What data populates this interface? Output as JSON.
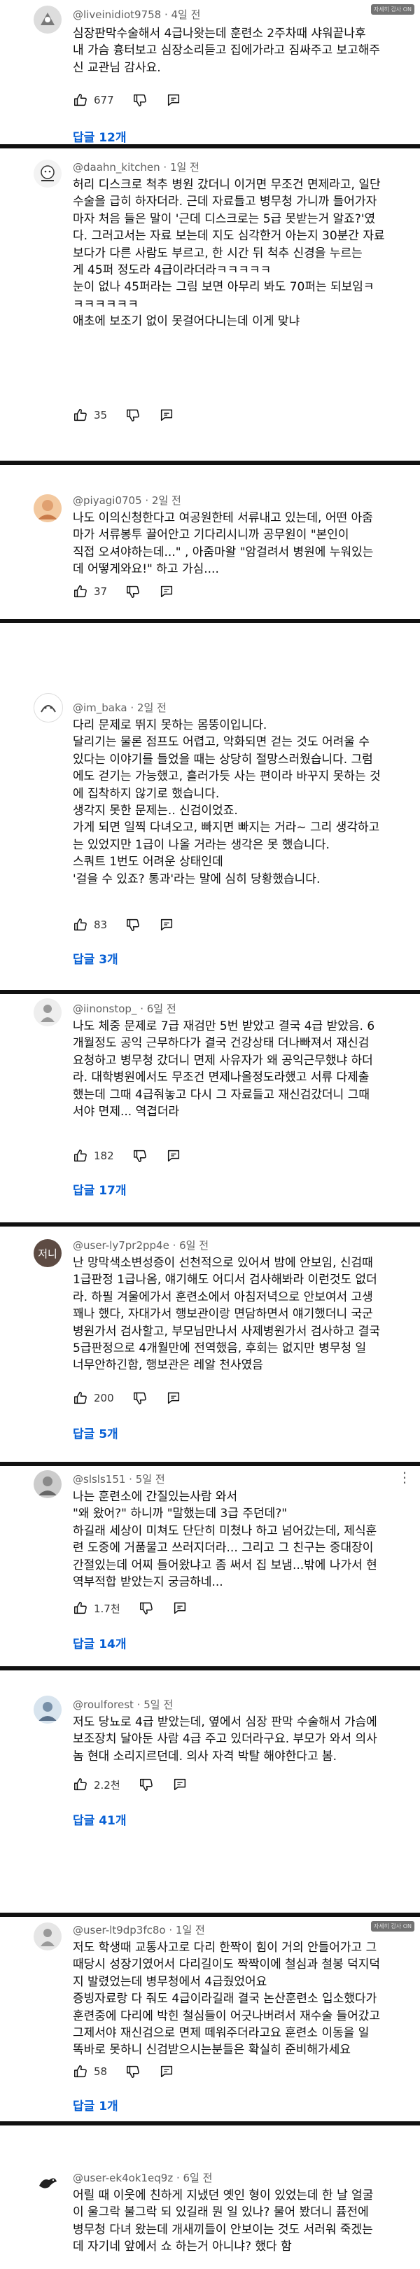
{
  "labels": {
    "replies_1": "답글 12개",
    "replies_3": "답글 3개",
    "replies_4": "답글 17개",
    "replies_5": "답글 5개",
    "replies_6": "답글 14개",
    "replies_7": "답글 41개",
    "replies_8": "답글 1개"
  },
  "comments": [
    {
      "handle": "@liveinidiot9758 · 4일 전",
      "text": "심장판막수술해서 4급나왓는데 훈련소 2주차때 샤워끝나후\n내 가슴 흉터보고 심장소리듣고 집에가라고 짐싸주고 보고해주\n신 교관님 감사요.",
      "likes": "677",
      "overlay": "자세히 감사 ON"
    },
    {
      "handle": "@daahn_kitchen · 1일 전",
      "text": "허리 디스크로 척추 병원 갔더니 이거면 무조건 면제라고, 일단\n수술을 급히 하자더라. 근데 자료들고 병무청 가니까 들어가자\n마자 처음 들은 말이 '근데 디스크로는 5급 못받는거 알죠?'였\n다. 그러고서는 자료 보는데 지도 심각한거 아는지 30분간 자료\n보다가 다른 사람도 부르고, 한 시간 뒤 척추 신경을 누르는\n게 45퍼 정도라 4급이라더라ㅋㅋㅋㅋㅋ\n눈이 없나 45퍼라는 그림 보면 아무리 봐도 70퍼는 되보임ㅋ\nㅋㅋㅋㅋㅋㅋ\n애초에 보조기 없이 못걸어다니는데 이게 맞냐",
      "likes": "35"
    },
    {
      "handle": "@piyagi0705 · 2일 전",
      "text": "나도 이의신청한다고 여공원한테 서류내고 있는데, 어떤 아줌\n마가 서류봉투 끌어안고 기다리시니까  공무원이 \"본인이\n직접 오셔야하는데...\" , 아줌마왈 \"암걸려서 병원에 누워있는\n데 어떻게와요!\" 하고 가심....",
      "likes": "37"
    },
    {
      "handle": "@im_baka · 2일 전",
      "text": "다리 문제로 뛰지 못하는 몸뚱이입니다.\n달리기는 물론 점프도 어렵고, 악화되면 걷는 것도 어려울 수\n있다는 이야기를 들었을 때는 상당히 절망스러웠습니다. 그럼\n에도 걷기는 가능했고, 흘러가듯 사는 편이라 바꾸지 못하는 것\n에 집착하지 않기로 했습니다.\n생각지 못한 문제는.. 신검이었죠.\n가게 되면 일찍 다녀오고, 빠지면 빠지는 거라~ 그리 생각하고\n는 있었지만 1급이 나올 거라는 생각은 못 했습니다.\n스쿼트 1번도 어려운 상태인데\n'걸을 수 있죠? 통과'라는 말에 심히 당황했습니다.",
      "likes": "83"
    },
    {
      "handle": "@iinonstop_ · 6일 전",
      "text": "나도 체중 문제로 7급 재검만 5번 받았고 결국 4급 받았음. 6\n개월정도 공익 근무하다가 결국 건강상태 더나빠져서 재신검\n요청하고 병무청 갔더니 면제 사유자가 왜 공익근무했냐 하더\n라.  대학병원에서도 무조건 면제나올정도라했고 서류 다제출\n했는데 그때 4급줘놓고 다시 그 자료들고 재신검갔더니 그때\n서야 면제... 역겹더라",
      "likes": "182"
    },
    {
      "handle": "@user-ly7pr2pp4e · 6일 전",
      "text": "난 망막색소변성증이 선천적으로 있어서 밤에 안보임, 신검때\n1급판정 1급나옴, 얘기해도 어디서 검사해봐라 이런것도 없더\n라. 하필 겨울에가서 훈련소에서 아침저녁으로 안보여서 고생\n꽤나 했다, 자대가서 행보관이랑 면담하면서 얘기했더니 국군\n병원가서 검사할고, 부모님만나서 사제병원가서 검사하고 결국\n5급판정으로 4개월만에 전역했음, 후회는 없지만 병무청 일\n너무안하긴함, 행보관은 레알 천사였음",
      "likes": "200"
    },
    {
      "handle": "@slsls151 · 5일 전",
      "text": "나는 훈련소에 간질있는사람 와서\n\"왜 왔어?\" 하니까  \"말했는데 3급 주던데?\"\n하길래 세상이 미쳐도 단단히 미쳤나 하고 넘어갔는데, 제식훈\n련 도중에 거품물고 쓰러지더라... 그리고 그 친구는 중대장이\n간절있는데 어찌 들어왔냐고 좀 써서 집 보냄...밖에 나가서 현\n역부적합 받았는지 궁금하네...",
      "likes": "1.7천"
    },
    {
      "handle": "@roulforest · 5일 전",
      "text": "저도 당뇨로 4급 받았는데, 옆에서 심장 판막 수술해서 가슴에\n보조장치 달아둔 사람 4급 주고 있더라구요. 부모가 와서 의사\n놈 현대 소리지르던데. 의사 자격 박탈 해야한다고 봄.",
      "likes": "2.2천"
    },
    {
      "handle": "@user-lt9dp3fc8o · 1일 전",
      "text": "저도 학생때 교통사고로 다리 한짝이 힘이 거의 안들어가고 그\n때당시 성장기였어서 다리길이도 짝짝이에 철심과 철봉 덕지덕\n지 발렸었는데 병무청에서 4급줬었어요\n증빙자료랑 다 줘도 4급이라길래 결국 논산훈련소 입소했다가\n훈련중에 다리에 박힌 철심들이 어긋나버려서 재수술 들어갔고\n그제서야 재신검으로 면제 떼워주더라고요 훈련소 이동을 일\n똑바로 못하니 신검받으시는분들은 확실히 준비해가세요",
      "likes": "58",
      "overlay": "자세히 감사 ON"
    },
    {
      "handle": "@user-ek4ok1eq9z · 6일 전",
      "text": "어릴 때 이웃에 친하게 지냈던 옛인 형이 있었는데 한 날 얼굴\n이 울그락 불그락 되 있길래 뭔 일 있나? 물어 봤더니 퓸전에\n병무청 다녀 왔는데 개새끼들이 안보이는 것도 서러워 죽겠는\n데 자기네 앞에서 쇼 하는거 아니냐? 했다 함"
    }
  ]
}
